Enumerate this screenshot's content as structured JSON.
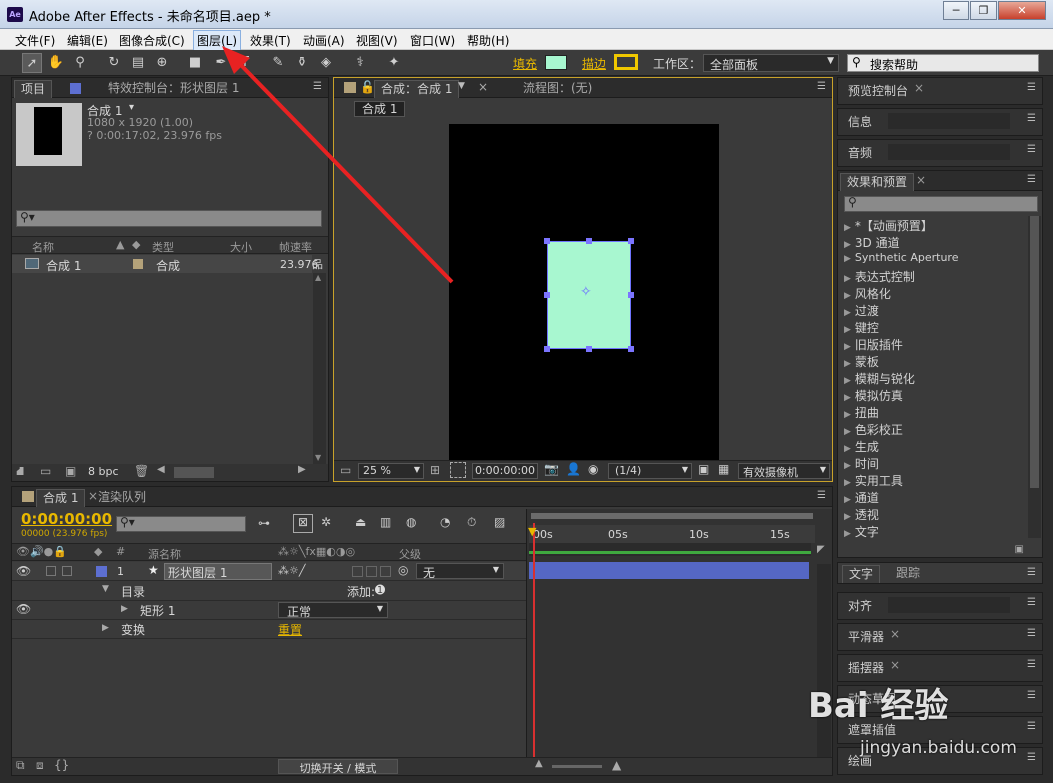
{
  "window": {
    "app_icon": "Ae",
    "title": "Adobe After Effects - 未命名项目.aep *"
  },
  "menu": [
    "文件(F)",
    "编辑(E)",
    "图像合成(C)",
    "图层(L)",
    "效果(T)",
    "动画(A)",
    "视图(V)",
    "窗口(W)",
    "帮助(H)"
  ],
  "toolbar": {
    "fill_label": "填充",
    "stroke_label": "描边",
    "workspace_label": "工作区：",
    "workspace_value": "全部面板",
    "search_placeholder": "搜索帮助",
    "fill_color": "#a8f7d0",
    "stroke_color": "#f0c800"
  },
  "project": {
    "tab_project": "项目",
    "tab_effects": "特效控制台：形状图层 1",
    "comp_name": "合成 1",
    "comp_size": "1080 x 1920 (1.00)",
    "comp_duration": "? 0:00:17:02, 23.976 fps",
    "columns": [
      "名称",
      "类型",
      "大小",
      "帧速率"
    ],
    "row": {
      "name": "合成 1",
      "type": "合成",
      "fps": "23.976"
    },
    "bpc": "8 bpc"
  },
  "viewer": {
    "tab_comp": "合成：合成 1",
    "tab_flow": "流程图：(无)",
    "sub_tab": "合成 1",
    "zoom": "25 %",
    "timecode": "0:00:00:00",
    "resolution": "(1/4)",
    "camera": "有效摄像机",
    "shape_color": "#a8f7d0"
  },
  "right_panels": {
    "preview": "预览控制台",
    "info": "信息",
    "audio": "音频",
    "effects_presets": "效果和预置",
    "effects_list": [
      "*【动画预置】",
      "3D 通道",
      "Synthetic Aperture",
      "表达式控制",
      "风格化",
      "过渡",
      "键控",
      "旧版插件",
      "蒙板",
      "模糊与锐化",
      "模拟仿真",
      "扭曲",
      "色彩校正",
      "生成",
      "时间",
      "实用工具",
      "通道",
      "透视",
      "文字"
    ],
    "text_tab": "文字",
    "track_tab": "跟踪",
    "align": "对齐",
    "smoother": "平滑器",
    "wiggler": "摇摆器",
    "motion_sketch": "动态草图",
    "mask_interp": "遮罩插值",
    "paint": "绘画"
  },
  "timeline": {
    "tab_comp": "合成 1",
    "tab_render": "渲染队列",
    "timecode": "0:00:00:00",
    "frame_info": "00000 (23.976 fps)",
    "col_source": "源名称",
    "col_parent": "父级",
    "layer_num": "1",
    "layer_name": "形状图层 1",
    "parent_value": "无",
    "contents": "目录",
    "add_label": "添加:",
    "rect": "矩形 1",
    "blend": "正常",
    "transform": "变换",
    "reset": "重置",
    "ticks": [
      "00s",
      "05s",
      "10s",
      "15s"
    ],
    "switch_mode": "切换开关 / 模式"
  },
  "watermark": {
    "brand": "Bai 经验",
    "url": "jingyan.baidu.com"
  }
}
